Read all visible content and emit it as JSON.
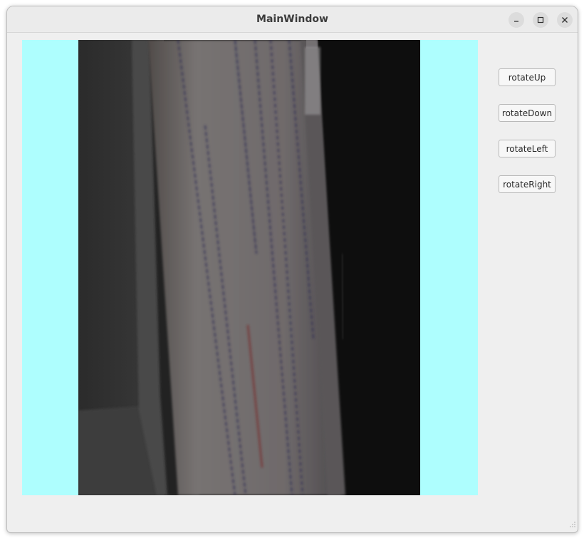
{
  "window": {
    "title": "MainWindow",
    "controls": [
      {
        "name": "minimize",
        "icon": "minimize-icon"
      },
      {
        "name": "maximize",
        "icon": "maximize-icon"
      },
      {
        "name": "close",
        "icon": "close-icon"
      }
    ]
  },
  "video": {
    "background_color": "#aefefe",
    "frame_color": "#0e0e0e"
  },
  "buttons": {
    "rotate_up": "rotateUp",
    "rotate_down": "rotateDown",
    "rotate_left": "rotateLeft",
    "rotate_right": "rotateRight"
  }
}
